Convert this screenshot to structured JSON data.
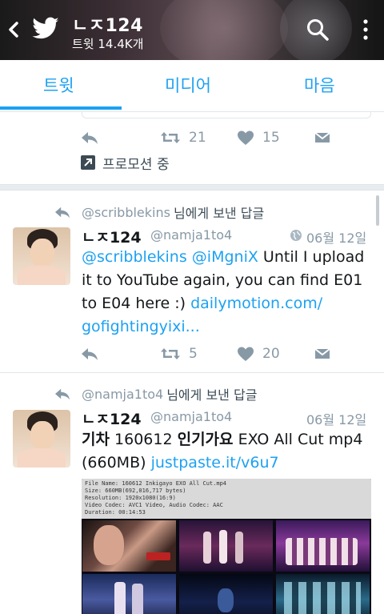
{
  "header": {
    "title": "ㄴㅈ124",
    "subtitle": "트윗 14.4K개"
  },
  "tabs": [
    {
      "label": "트윗",
      "active": true
    },
    {
      "label": "미디어",
      "active": false
    },
    {
      "label": "마음",
      "active": false
    }
  ],
  "colors": {
    "accent": "#1da1f2",
    "muted": "#8899a6",
    "text": "#14171a"
  },
  "tweets": [
    {
      "retweets": "21",
      "likes": "15",
      "promoted_label": "프로모션 중"
    },
    {
      "context_handle": "@scribblekins",
      "context_suffix": "님에게 보낸 답글",
      "name": "ㄴㅈ124",
      "handle": "@namja1to4",
      "date": "06월 12일",
      "mention1": "@scribblekins",
      "mention2": "@iMgniX",
      "text_line1": "Until I upload",
      "text_line2": "it to YouTube again, you can find E01",
      "text_line3": "to E04 here :)",
      "link1": "dailymotion.com/",
      "link2": "gofightingyixi...",
      "retweets": "5",
      "likes": "20"
    },
    {
      "context_handle": "@namja1to4",
      "context_suffix": "님에게 보낸 답글",
      "name": "ㄴㅈ124",
      "handle": "@namja1to4",
      "date": "06월 12일",
      "word1": "기차",
      "word2": "160612",
      "word3": "인기가요",
      "word4": "EXO All Cut mp4",
      "line2": "(660MB)",
      "link": "justpaste.it/v6u7",
      "media_info": [
        "File Name: 160612 Inkigayo EXO All Cut.mp4",
        "Size: 660MB(692,016,717 bytes)",
        "Resolution: 1920x1080(16:9)",
        "Video Codec: AVC1 Video, Audio Codec: AAC",
        "Duration: 00:14:53"
      ]
    }
  ]
}
